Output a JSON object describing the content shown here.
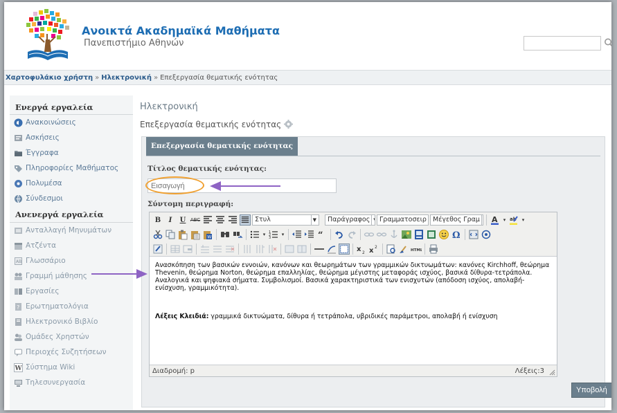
{
  "header": {
    "site_title": "Ανοικτά Ακαδημαϊκά Μαθήματα",
    "site_subtitle": "Πανεπιστήμιο Αθηνών",
    "search_placeholder": "",
    "search_icon": "search-icon"
  },
  "breadcrumb": {
    "items": [
      "Χαρτοφυλάκιο χρήστη",
      "Ηλεκτρονική",
      "Επεξεργασία θεματικής ενότητας"
    ],
    "separator": "»"
  },
  "sidebar": {
    "active_heading": "Ενεργά εργαλεία",
    "active_items": [
      {
        "label": "Ανακοινώσεις",
        "icon": "announcements-icon"
      },
      {
        "label": "Ασκήσεις",
        "icon": "exercises-icon"
      },
      {
        "label": "Έγγραφα",
        "icon": "documents-icon"
      },
      {
        "label": "Πληροφορίες Μαθήματος",
        "icon": "course-info-icon"
      },
      {
        "label": "Πολυμέσα",
        "icon": "multimedia-icon"
      },
      {
        "label": "Σύνδεσμοι",
        "icon": "links-icon"
      }
    ],
    "inactive_heading": "Ανενεργά εργαλεία",
    "inactive_items": [
      {
        "label": "Ανταλλαγή Μηνυμάτων",
        "icon": "messages-icon"
      },
      {
        "label": "Ατζέντα",
        "icon": "agenda-icon"
      },
      {
        "label": "Γλωσσάριο",
        "icon": "glossary-icon"
      },
      {
        "label": "Γραμμή μάθησης",
        "icon": "learning-path-icon"
      },
      {
        "label": "Εργασίες",
        "icon": "assignments-icon"
      },
      {
        "label": "Ερωτηματολόγια",
        "icon": "questionnaires-icon"
      },
      {
        "label": "Ηλεκτρονικό Βιβλίο",
        "icon": "ebook-icon"
      },
      {
        "label": "Ομάδες Χρηστών",
        "icon": "user-groups-icon"
      },
      {
        "label": "Περιοχές Συζητήσεων",
        "icon": "forums-icon"
      },
      {
        "label": "Σύστημα Wiki",
        "icon": "wiki-icon"
      },
      {
        "label": "Τηλεσυνεργασία",
        "icon": "teleconference-icon"
      }
    ]
  },
  "main": {
    "course_title": "Ηλεκτρονική",
    "page_heading": "Επεξεργασία θεματικής ενότητας",
    "panel_title": "Επεξεργασία θεματικής ενότητας",
    "title_label": "Τίτλος θεματικής ενότητας:",
    "title_value": "Εισαγωγή",
    "description_label": "Σύντομη περιγραφή:",
    "submit_label": "Υποβολή"
  },
  "editor": {
    "style_select": "Στυλ",
    "paragraph_select": "Παράγραφος",
    "font_select": "Γραμματοσειρ",
    "size_select": "Μέγεθος Γραμ",
    "bold": "B",
    "italic": "I",
    "underline": "U",
    "strike": "ABC",
    "content": "Ανασκόπηση των βασικών εννοιών, κανόνων και θεωρημάτων των γραμμικών δικτυωμάτων: κανόνες Kirchhoff, θεώρημα Thevenin, θεώρημα Norton, θεώρημα επαλληλίας, θεώρημα μέγιστης μεταφοράς ισχύος, βασικά δίθυρα-τετράπολα. Αναλογικά και ψηφιακά σήματα. Συμβολισμοί. Βασικά χαρακτηριστικά των ενισχυτών (απόδοση ισχύος, απολαβή-ενίσχυση, γραμμικότητα).",
    "keywords_label": "Λέξεις Κλειδιά:",
    "keywords_value": " γραμμικά δικτυώματα, δίθυρα ή τετράπολα, υβριδικές παράμετροι, απολαβή ή ενίσχυση",
    "path_label": "Διαδρομή: p",
    "word_count": "Λέξεις:3"
  },
  "colors": {
    "accent": "#1d6db3",
    "panel_header": "#6b7f8d",
    "highlight_circle": "#f0a030",
    "annotation_arrow": "#8e63c4"
  }
}
